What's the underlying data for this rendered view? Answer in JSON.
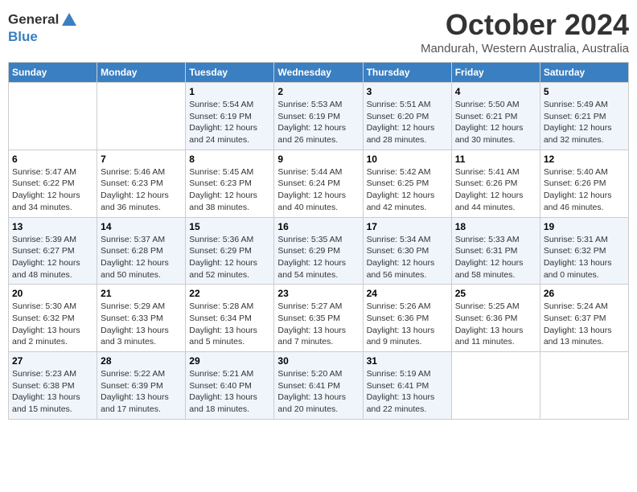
{
  "header": {
    "logo_general": "General",
    "logo_blue": "Blue",
    "title": "October 2024",
    "subtitle": "Mandurah, Western Australia, Australia"
  },
  "days_of_week": [
    "Sunday",
    "Monday",
    "Tuesday",
    "Wednesday",
    "Thursday",
    "Friday",
    "Saturday"
  ],
  "weeks": [
    [
      {
        "day": "",
        "info": ""
      },
      {
        "day": "",
        "info": ""
      },
      {
        "day": "1",
        "info": "Sunrise: 5:54 AM\nSunset: 6:19 PM\nDaylight: 12 hours and 24 minutes."
      },
      {
        "day": "2",
        "info": "Sunrise: 5:53 AM\nSunset: 6:19 PM\nDaylight: 12 hours and 26 minutes."
      },
      {
        "day": "3",
        "info": "Sunrise: 5:51 AM\nSunset: 6:20 PM\nDaylight: 12 hours and 28 minutes."
      },
      {
        "day": "4",
        "info": "Sunrise: 5:50 AM\nSunset: 6:21 PM\nDaylight: 12 hours and 30 minutes."
      },
      {
        "day": "5",
        "info": "Sunrise: 5:49 AM\nSunset: 6:21 PM\nDaylight: 12 hours and 32 minutes."
      }
    ],
    [
      {
        "day": "6",
        "info": "Sunrise: 5:47 AM\nSunset: 6:22 PM\nDaylight: 12 hours and 34 minutes."
      },
      {
        "day": "7",
        "info": "Sunrise: 5:46 AM\nSunset: 6:23 PM\nDaylight: 12 hours and 36 minutes."
      },
      {
        "day": "8",
        "info": "Sunrise: 5:45 AM\nSunset: 6:23 PM\nDaylight: 12 hours and 38 minutes."
      },
      {
        "day": "9",
        "info": "Sunrise: 5:44 AM\nSunset: 6:24 PM\nDaylight: 12 hours and 40 minutes."
      },
      {
        "day": "10",
        "info": "Sunrise: 5:42 AM\nSunset: 6:25 PM\nDaylight: 12 hours and 42 minutes."
      },
      {
        "day": "11",
        "info": "Sunrise: 5:41 AM\nSunset: 6:26 PM\nDaylight: 12 hours and 44 minutes."
      },
      {
        "day": "12",
        "info": "Sunrise: 5:40 AM\nSunset: 6:26 PM\nDaylight: 12 hours and 46 minutes."
      }
    ],
    [
      {
        "day": "13",
        "info": "Sunrise: 5:39 AM\nSunset: 6:27 PM\nDaylight: 12 hours and 48 minutes."
      },
      {
        "day": "14",
        "info": "Sunrise: 5:37 AM\nSunset: 6:28 PM\nDaylight: 12 hours and 50 minutes."
      },
      {
        "day": "15",
        "info": "Sunrise: 5:36 AM\nSunset: 6:29 PM\nDaylight: 12 hours and 52 minutes."
      },
      {
        "day": "16",
        "info": "Sunrise: 5:35 AM\nSunset: 6:29 PM\nDaylight: 12 hours and 54 minutes."
      },
      {
        "day": "17",
        "info": "Sunrise: 5:34 AM\nSunset: 6:30 PM\nDaylight: 12 hours and 56 minutes."
      },
      {
        "day": "18",
        "info": "Sunrise: 5:33 AM\nSunset: 6:31 PM\nDaylight: 12 hours and 58 minutes."
      },
      {
        "day": "19",
        "info": "Sunrise: 5:31 AM\nSunset: 6:32 PM\nDaylight: 13 hours and 0 minutes."
      }
    ],
    [
      {
        "day": "20",
        "info": "Sunrise: 5:30 AM\nSunset: 6:32 PM\nDaylight: 13 hours and 2 minutes."
      },
      {
        "day": "21",
        "info": "Sunrise: 5:29 AM\nSunset: 6:33 PM\nDaylight: 13 hours and 3 minutes."
      },
      {
        "day": "22",
        "info": "Sunrise: 5:28 AM\nSunset: 6:34 PM\nDaylight: 13 hours and 5 minutes."
      },
      {
        "day": "23",
        "info": "Sunrise: 5:27 AM\nSunset: 6:35 PM\nDaylight: 13 hours and 7 minutes."
      },
      {
        "day": "24",
        "info": "Sunrise: 5:26 AM\nSunset: 6:36 PM\nDaylight: 13 hours and 9 minutes."
      },
      {
        "day": "25",
        "info": "Sunrise: 5:25 AM\nSunset: 6:36 PM\nDaylight: 13 hours and 11 minutes."
      },
      {
        "day": "26",
        "info": "Sunrise: 5:24 AM\nSunset: 6:37 PM\nDaylight: 13 hours and 13 minutes."
      }
    ],
    [
      {
        "day": "27",
        "info": "Sunrise: 5:23 AM\nSunset: 6:38 PM\nDaylight: 13 hours and 15 minutes."
      },
      {
        "day": "28",
        "info": "Sunrise: 5:22 AM\nSunset: 6:39 PM\nDaylight: 13 hours and 17 minutes."
      },
      {
        "day": "29",
        "info": "Sunrise: 5:21 AM\nSunset: 6:40 PM\nDaylight: 13 hours and 18 minutes."
      },
      {
        "day": "30",
        "info": "Sunrise: 5:20 AM\nSunset: 6:41 PM\nDaylight: 13 hours and 20 minutes."
      },
      {
        "day": "31",
        "info": "Sunrise: 5:19 AM\nSunset: 6:41 PM\nDaylight: 13 hours and 22 minutes."
      },
      {
        "day": "",
        "info": ""
      },
      {
        "day": "",
        "info": ""
      }
    ]
  ]
}
